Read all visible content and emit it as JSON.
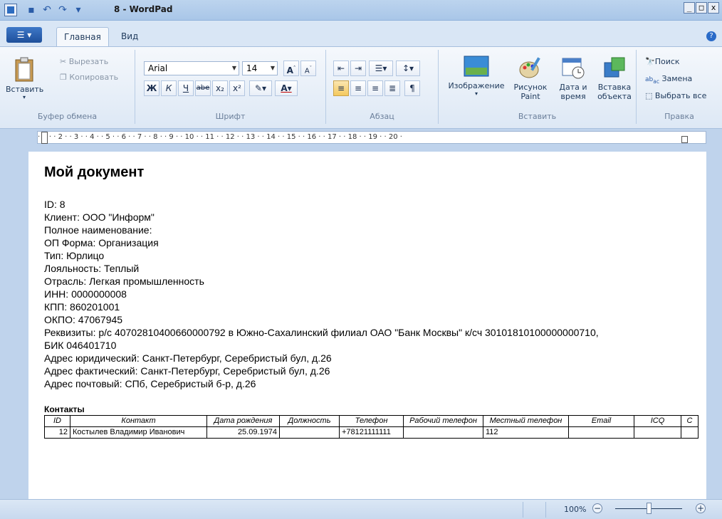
{
  "titlebar": {
    "title": "8 - WordPad",
    "min_icon": "minimize-icon",
    "max_icon": "maximize-icon",
    "close_icon": "close-icon"
  },
  "tabs": {
    "menu_label": "☰ ▾",
    "home": "Главная",
    "view": "Вид"
  },
  "ribbon": {
    "clipboard": {
      "paste": "Вставить",
      "cut": "Вырезать",
      "copy": "Копировать",
      "group": "Буфер обмена"
    },
    "font": {
      "family": "Arial",
      "size": "14",
      "bold": "Ж",
      "italic": "К",
      "underline": "Ч",
      "strike": "abe",
      "sub": "x₂",
      "sup": "x²",
      "group": "Шрифт"
    },
    "paragraph": {
      "group": "Абзац"
    },
    "insert": {
      "image": "Изображение",
      "paint_1": "Рисунок",
      "paint_2": "Paint",
      "datetime_1": "Дата и",
      "datetime_2": "время",
      "object_1": "Вставка",
      "object_2": "объекта",
      "group": "Вставить"
    },
    "editing": {
      "find": "Поиск",
      "replace": "Замена",
      "select_all": "Выбрать все",
      "group": "Правка"
    }
  },
  "ruler": {
    "ticks": "· 1 · · 2 · · 3 · · 4 · · 5 · · 6 · · 7 · · 8 · · 9 · · 10 · · 11 · · 12 · · 13 · · 14 · · 15 · · 16 · · 17 · · 18 · · 19 · · 20 ·"
  },
  "document": {
    "title": "Мой документ",
    "lines": [
      "ID: 8",
      "Клиент: ООО \"Информ\"",
      "Полное наименование:",
      "ОП Форма: Организация",
      "Тип: Юрлицо",
      "Лояльность: Теплый",
      "Отрасль: Легкая промышленность",
      "ИНН: 0000000008",
      "КПП: 860201001",
      "ОКПО: 47067945",
      "Реквизиты: р/с 40702810400660000792 в Южно-Сахалинский филиал ОАО \"Банк Москвы\" к/сч 30101810100000000710,",
      "БИК 046401710",
      "Адрес юридический: Санкт-Петербург, Серебристый бул, д.26",
      "Адрес фактический: Санкт-Петербург, Серебристый бул, д.26",
      "Адрес почтовый: СПб, Серебристый б-р, д.26"
    ],
    "contacts_title": "Контакты",
    "table": {
      "headers": [
        "ID",
        "Контакт",
        "Дата рождения",
        "Должность",
        "Телефон",
        "Рабочий телефон",
        "Местный телефон",
        "Email",
        "ICQ",
        "C"
      ],
      "row": [
        "12",
        "Костылев Владимир Иванович",
        "25.09.1974",
        "",
        "+78121111111",
        "",
        "112",
        "",
        "",
        ""
      ]
    }
  },
  "statusbar": {
    "zoom": "100%",
    "zoom_out": "−",
    "zoom_in": "+",
    "zoom_level": 1.0
  }
}
